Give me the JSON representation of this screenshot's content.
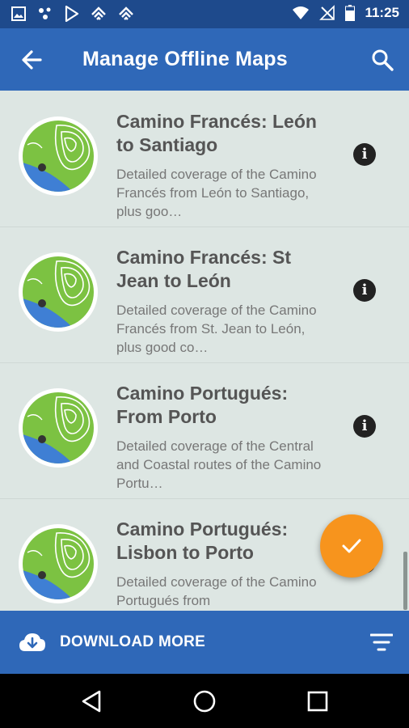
{
  "status_bar": {
    "time": "11:25",
    "left_icons": [
      "image-icon",
      "dots-icon",
      "play-store-icon",
      "feedly-icon",
      "feedly-icon"
    ],
    "right_icons": [
      "wifi-icon",
      "no-signal-icon",
      "battery-icon"
    ]
  },
  "app_bar": {
    "title": "Manage Offline Maps",
    "back_icon": "arrow-back-icon",
    "search_icon": "search-icon"
  },
  "maps": [
    {
      "title": "Camino Francés: León to Santiago",
      "description": "Detailed coverage of the Camino Francés from León to Santiago, plus goo…"
    },
    {
      "title": "Camino Francés: St Jean to León",
      "description": "Detailed coverage of the Camino Francés from St. Jean to León, plus good co…"
    },
    {
      "title": "Camino Portugués: From Porto",
      "description": "Detailed coverage of the Central and Coastal routes of the Camino Portu…"
    },
    {
      "title": "Camino Portugués: Lisbon to Porto",
      "description": "Detailed coverage of the Camino Portugués from"
    }
  ],
  "fab": {
    "icon": "check-icon",
    "color": "#f7941d"
  },
  "bottom_bar": {
    "download_label": "DOWNLOAD MORE",
    "download_icon": "cloud-download-icon",
    "filter_icon": "filter-icon"
  },
  "colors": {
    "primary": "#2f68b8",
    "status_bar": "#1e4a8c",
    "list_background": "#dde6e3",
    "accent": "#f7941d"
  }
}
